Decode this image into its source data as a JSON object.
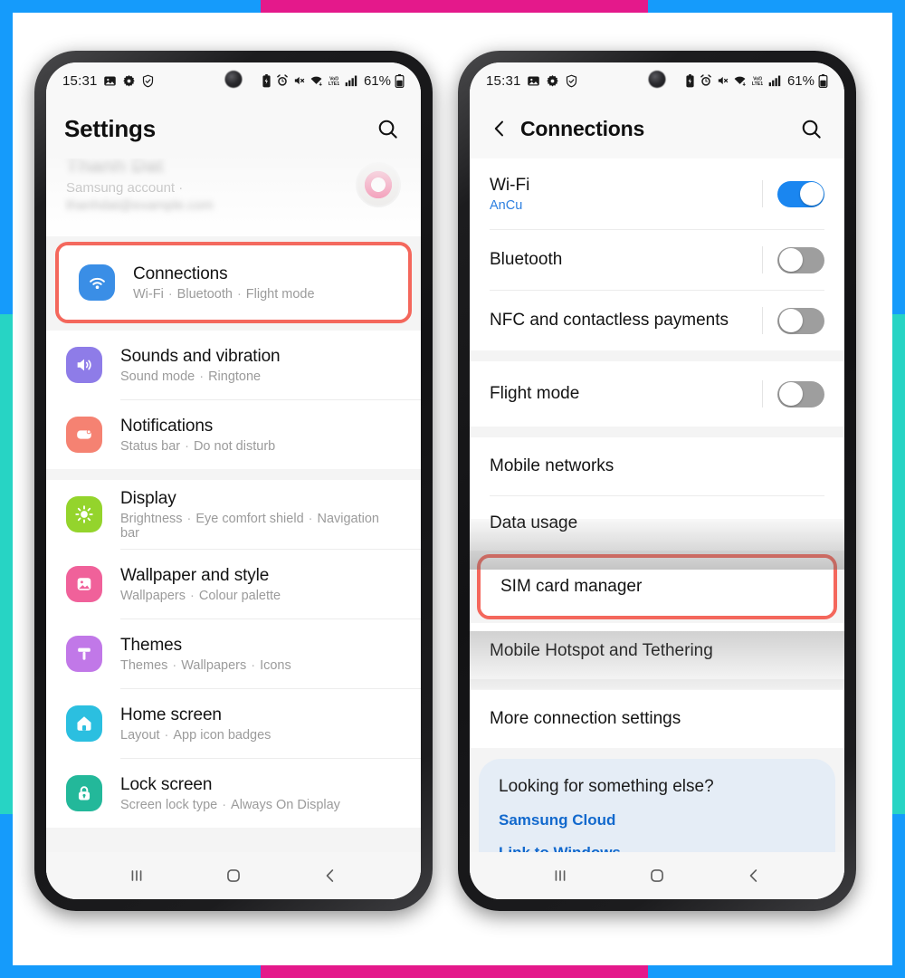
{
  "frame": {
    "border_color": "#159bfb",
    "accent_top_color": "#e4198b",
    "accent_side_color": "#27d4c4"
  },
  "status_bar": {
    "time": "15:31",
    "battery_percent": "61%",
    "left_icons": [
      "gallery-icon",
      "settings-gear-icon",
      "shield-check-icon"
    ],
    "right_icons": [
      "battery-saver-icon",
      "alarm-icon",
      "mute-icon",
      "wifi-icon",
      "volte-icon",
      "signal-bars-icon",
      "battery-icon"
    ]
  },
  "phone_left": {
    "header": {
      "title": "Settings",
      "search_icon": "search-icon"
    },
    "account": {
      "name": "Thanh Dat",
      "subtitle": "Samsung account  ·",
      "email": "thanhdat@example.com",
      "avatar": "profile-avatar"
    },
    "highlight_color": "#f4675c",
    "items": [
      {
        "icon": "wifi-icon",
        "icon_color": "#3a8ee6",
        "title": "Connections",
        "subtitle": [
          "Wi-Fi",
          "Bluetooth",
          "Flight mode"
        ],
        "highlighted": true
      },
      {
        "icon": "volume-icon",
        "icon_color": "#8e7ce8",
        "title": "Sounds and vibration",
        "subtitle": [
          "Sound mode",
          "Ringtone"
        ],
        "highlighted": false
      },
      {
        "icon": "notification-icon",
        "icon_color": "#f58272",
        "title": "Notifications",
        "subtitle": [
          "Status bar",
          "Do not disturb"
        ],
        "highlighted": false
      },
      {
        "icon": "brightness-icon",
        "icon_color": "#94d42c",
        "title": "Display",
        "subtitle": [
          "Brightness",
          "Eye comfort shield",
          "Navigation bar"
        ],
        "highlighted": false
      },
      {
        "icon": "image-icon",
        "icon_color": "#f0619a",
        "title": "Wallpaper and style",
        "subtitle": [
          "Wallpapers",
          "Colour palette"
        ],
        "highlighted": false
      },
      {
        "icon": "paint-roller-icon",
        "icon_color": "#c178e8",
        "title": "Themes",
        "subtitle": [
          "Themes",
          "Wallpapers",
          "Icons"
        ],
        "highlighted": false
      },
      {
        "icon": "home-icon",
        "icon_color": "#2bbfe0",
        "title": "Home screen",
        "subtitle": [
          "Layout",
          "App icon badges"
        ],
        "highlighted": false
      },
      {
        "icon": "lock-icon",
        "icon_color": "#23b89a",
        "title": "Lock screen",
        "subtitle": [
          "Screen lock type",
          "Always On Display"
        ],
        "highlighted": false
      }
    ]
  },
  "phone_right": {
    "header": {
      "back_icon": "back-chevron-icon",
      "title": "Connections",
      "search_icon": "search-icon"
    },
    "highlight_color": "#f4675c",
    "toggle_on_color": "#1a86f0",
    "toggle_off_color": "#9e9e9e",
    "link_color": "#1269cd",
    "rows": [
      {
        "title": "Wi-Fi",
        "subtitle": "AnCu",
        "toggle": "on"
      },
      {
        "title": "Bluetooth",
        "subtitle": "",
        "toggle": "off"
      },
      {
        "title": "NFC and contactless payments",
        "subtitle": "",
        "toggle": "off"
      },
      {
        "title": "Flight mode",
        "subtitle": "",
        "toggle": "off"
      },
      {
        "title": "Mobile networks",
        "subtitle": "",
        "toggle": "none"
      },
      {
        "title": "Data usage",
        "subtitle": "",
        "toggle": "none"
      },
      {
        "title": "SIM card manager",
        "subtitle": "",
        "toggle": "none",
        "highlighted": true
      },
      {
        "title": "Mobile Hotspot and Tethering",
        "subtitle": "",
        "toggle": "none"
      },
      {
        "title": "More connection settings",
        "subtitle": "",
        "toggle": "none"
      }
    ],
    "looking": {
      "heading": "Looking for something else?",
      "links": [
        "Samsung Cloud",
        "Link to Windows"
      ]
    }
  },
  "nav_bar": {
    "recents": "recents-icon",
    "home": "home-circle-icon",
    "back": "back-chevron-icon"
  }
}
